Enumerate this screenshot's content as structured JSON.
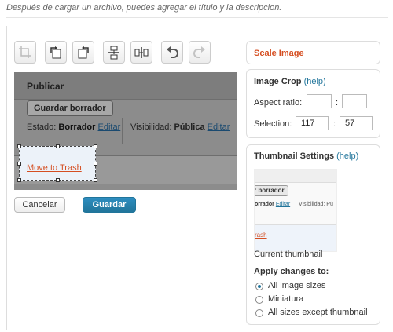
{
  "hint_text": "Después de cargar un archivo, puedes agregar el título y la descripcion.",
  "toolbar": {
    "buttons": [
      {
        "name": "crop",
        "enabled": false
      },
      {
        "name": "rotate-counterclockwise",
        "enabled": true
      },
      {
        "name": "rotate-clockwise",
        "enabled": true
      },
      {
        "name": "flip-vertical",
        "enabled": true
      },
      {
        "name": "flip-horizontal",
        "enabled": true
      },
      {
        "name": "undo",
        "enabled": true
      },
      {
        "name": "redo",
        "enabled": false
      }
    ]
  },
  "preview": {
    "title": "Publicar",
    "save_draft": "Guardar borrador",
    "status_label": "Estado:",
    "status_value": "Borrador",
    "edit1": "Editar",
    "visibility_label": "Visibilidad:",
    "visibility_value": "Pública",
    "edit2": "Editar",
    "crop_link": "Move to Trash"
  },
  "actions": {
    "cancel": "Cancelar",
    "save": "Guardar"
  },
  "scale": {
    "title": "Scale Image"
  },
  "crop": {
    "title": "Image Crop",
    "help": "(help)",
    "aspect_label": "Aspect ratio:",
    "aspect_w": "",
    "aspect_h": "",
    "separator": ":",
    "selection_label": "Selection:",
    "sel_w": "117",
    "sel_h": "57"
  },
  "thumbnail": {
    "title": "Thumbnail Settings",
    "help": "(help)",
    "thumb_button": "r borrador",
    "thumb_status": "orrador",
    "thumb_edit": "Editar",
    "thumb_vis": "Visibilidad: Pú",
    "thumb_link": "rash",
    "caption": "Current thumbnail",
    "apply_label": "Apply changes to:",
    "options": [
      {
        "label": "All image sizes",
        "selected": true
      },
      {
        "label": "Miniatura",
        "selected": false
      },
      {
        "label": "All sizes except thumbnail",
        "selected": false
      }
    ]
  },
  "colors": {
    "accent": "#21759b",
    "warning": "#d54e21"
  }
}
